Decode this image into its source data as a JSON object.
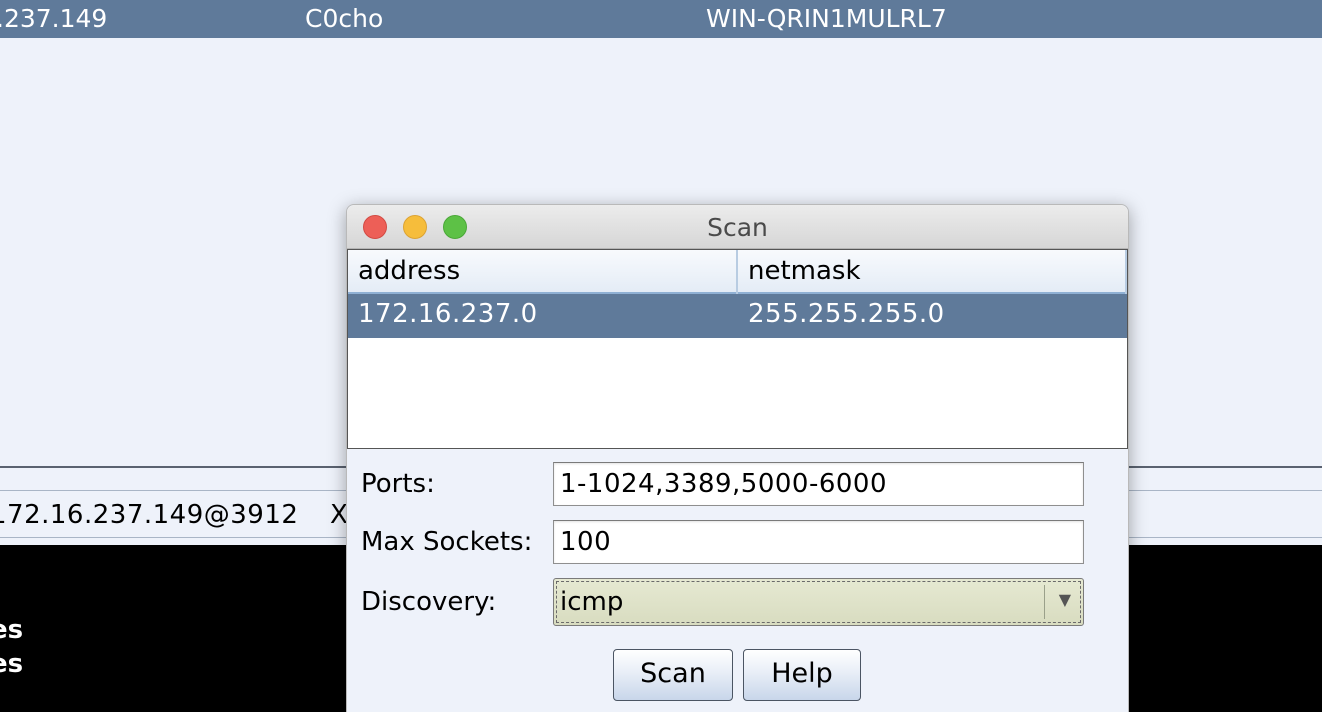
{
  "background": {
    "session_row": {
      "ip": ".237.149",
      "user": "C0cho",
      "computer": "WIN-QRIN1MULRL7"
    },
    "tab": {
      "label": "172.16.237.149@3912",
      "close": "X"
    },
    "console_lines": [
      "es",
      "es"
    ]
  },
  "dialog": {
    "title": "Scan",
    "table": {
      "columns": [
        "address",
        "netmask"
      ],
      "rows": [
        {
          "address": "172.16.237.0",
          "netmask": "255.255.255.0",
          "selected": true
        }
      ]
    },
    "form": {
      "ports_label": "Ports:",
      "ports_value": "1-1024,3389,5000-6000",
      "max_sockets_label": "Max Sockets:",
      "max_sockets_value": "100",
      "discovery_label": "Discovery:",
      "discovery_value": "icmp"
    },
    "buttons": {
      "scan": "Scan",
      "help": "Help"
    }
  },
  "colors": {
    "selection": "#5f7a9a",
    "window_bg": "#eef2fa",
    "console_bg": "#000000"
  },
  "icons": {
    "close": "close-icon",
    "minimize": "minimize-icon",
    "maximize": "maximize-icon",
    "dropdown": "chevron-down-icon"
  }
}
